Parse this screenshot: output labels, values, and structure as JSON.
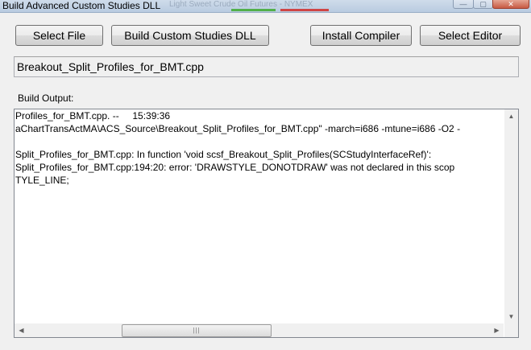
{
  "window": {
    "title": "Build Advanced Custom Studies DLL",
    "background_title_ghost": "Light Sweet Crude Oil Futures - NYMEX",
    "controls": {
      "minimize": "—",
      "maximize": "▢",
      "close": "✕"
    }
  },
  "toolbar": {
    "select_file": "Select File",
    "build": "Build Custom Studies DLL",
    "install_compiler": "Install Compiler",
    "select_editor": "Select Editor"
  },
  "file": {
    "name": "Breakout_Split_Profiles_for_BMT.cpp"
  },
  "output": {
    "label": "Build Output:",
    "lines": [
      "Profiles_for_BMT.cpp. --     15:39:36",
      "aChartTransActMA\\ACS_Source\\Breakout_Split_Profiles_for_BMT.cpp\" -march=i686 -mtune=i686 -O2 -",
      "",
      "Split_Profiles_for_BMT.cpp: In function 'void scsf_Breakout_Split_Profiles(SCStudyInterfaceRef)':",
      "Split_Profiles_for_BMT.cpp:194:20: error: 'DRAWSTYLE_DONOTDRAW' was not declared in this scop",
      "TYLE_LINE;"
    ]
  },
  "scrollbars": {
    "up_arrow": "▲",
    "down_arrow": "▼",
    "left_arrow": "◀",
    "right_arrow": "▶",
    "thumb_grip": "|||"
  },
  "colors": {
    "window_bg": "#f0f0f0",
    "titlebar": "#c4d4e6",
    "close_button": "#c75a43"
  }
}
